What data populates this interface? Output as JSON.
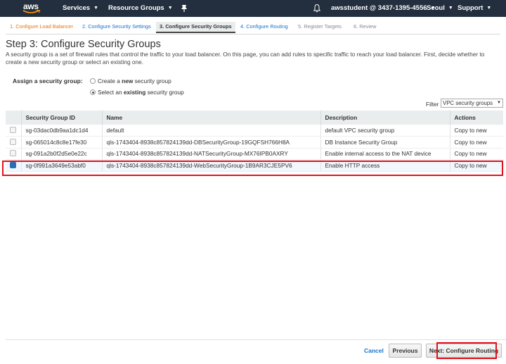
{
  "nav": {
    "logo": "aws",
    "services": "Services",
    "resource_groups": "Resource Groups",
    "account": "awsstudent @ 3437-1395-4556",
    "region": "Seoul",
    "support": "Support"
  },
  "steps": [
    "1. Configure Load Balancer",
    "2. Configure Security Settings",
    "3. Configure Security Groups",
    "4. Configure Routing",
    "5. Register Targets",
    "6. Review"
  ],
  "page": {
    "title": "Step 3: Configure Security Groups",
    "intro": "A security group is a set of firewall rules that control the traffic to your load balancer. On this page, you can add rules to specific traffic to reach your load balancer. First, decide whether to create a new security group or select an existing one."
  },
  "assign": {
    "label": "Assign a security group:",
    "option_new_prefix": "Create a ",
    "option_new_bold": "new",
    "option_new_suffix": " security group",
    "option_existing_prefix": "Select an ",
    "option_existing_bold": "existing",
    "option_existing_suffix": " security group",
    "selected": "existing"
  },
  "filter": {
    "label": "Filter",
    "value": "VPC security groups"
  },
  "table": {
    "headers": [
      "Security Group ID",
      "Name",
      "Description",
      "Actions"
    ],
    "rows": [
      {
        "id": "sg-03dac0db9aa1dc1d4",
        "name": "default",
        "description": "default VPC security group",
        "action": "Copy to new",
        "checked": false
      },
      {
        "id": "sg-065014c8c8e17fe30",
        "name": "qls-1743404-8938c857824139dd-DBSecurityGroup-19GQFSH766H8A",
        "description": "DB Instance Security Group",
        "action": "Copy to new",
        "checked": false
      },
      {
        "id": "sg-091a2b0f2d5e0e22c",
        "name": "qls-1743404-8938c857824139dd-NATSecurityGroup-MX76IPB0AXRY",
        "description": "Enable internal access to the NAT device",
        "action": "Copy to new",
        "checked": false
      },
      {
        "id": "sg-0f991a3649e53abf0",
        "name": "qls-1743404-8938c857824139dd-WebSecurityGroup-1B9AR3CJE5PV6",
        "description": "Enable HTTP access",
        "action": "Copy to new",
        "checked": true
      }
    ]
  },
  "footer": {
    "cancel": "Cancel",
    "previous": "Previous",
    "next": "Next: Configure Routing"
  },
  "colors": {
    "nav_bg": "#232f3e",
    "link": "#1a73c9",
    "done_step": "#e47911",
    "highlight": "#e0141b"
  }
}
